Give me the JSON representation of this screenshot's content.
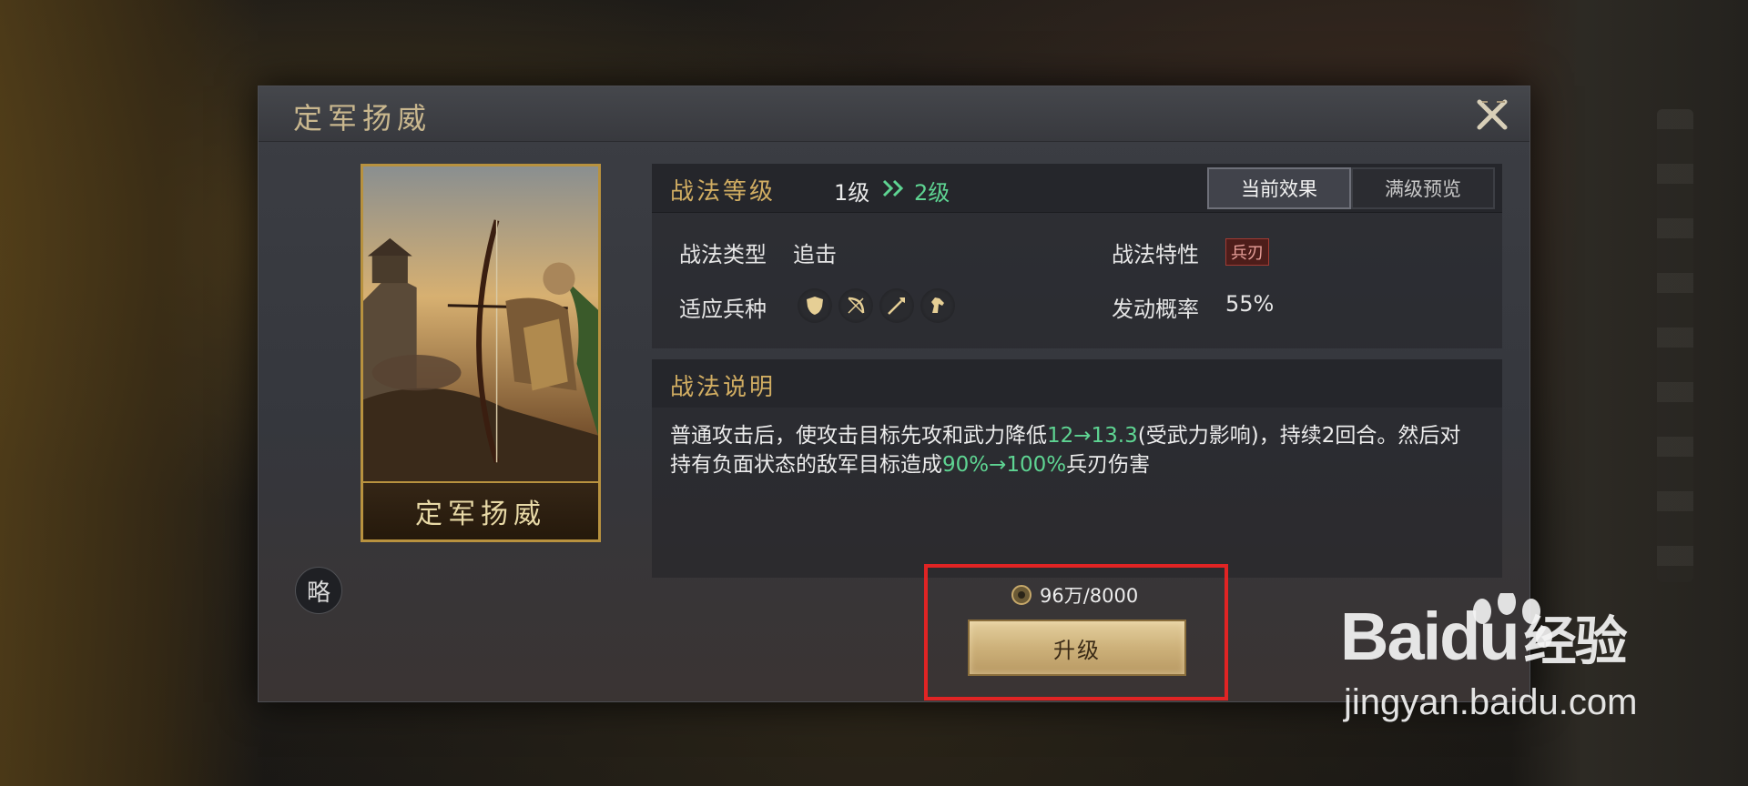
{
  "dialog": {
    "title": "定军扬威",
    "close_icon": "close-x-icon"
  },
  "card": {
    "name": "定军扬威",
    "art": "archer-warrior-illustration",
    "strategy_badge": "略"
  },
  "level_panel": {
    "label": "战法等级",
    "from": "1级",
    "to": "2级",
    "tabs": [
      {
        "label": "当前效果",
        "active": true
      },
      {
        "label": "满级预览",
        "active": false
      }
    ],
    "type_label": "战法类型",
    "type_value": "追击",
    "trait_label": "战法特性",
    "trait_value": "兵刃",
    "units_label": "适应兵种",
    "units_icons": [
      "shield-icon",
      "bow-icon",
      "spear-icon",
      "horse-icon"
    ],
    "rate_label": "发动概率",
    "rate_value": "55%"
  },
  "description": {
    "title": "战法说明",
    "part1": "普通攻击后，使攻击目标先攻和武力降低",
    "hl1": "12→13.3",
    "part2": "(受武力影响)，持续2回合。然后对持有负面状态的敌军目标造成",
    "hl2": "90%→100%",
    "part3": "兵刃伤害"
  },
  "upgrade": {
    "cost": "96万/8000",
    "coin_icon": "coin-icon",
    "button_label": "升级"
  },
  "watermark": {
    "brand": "Bai",
    "brand_du": "du",
    "brand_cn": "经验",
    "url": "jingyan.baidu.com"
  },
  "colors": {
    "accent_gold": "#d1ad62",
    "upgrade_green": "#5ed492",
    "highlight_red": "#e02424"
  }
}
